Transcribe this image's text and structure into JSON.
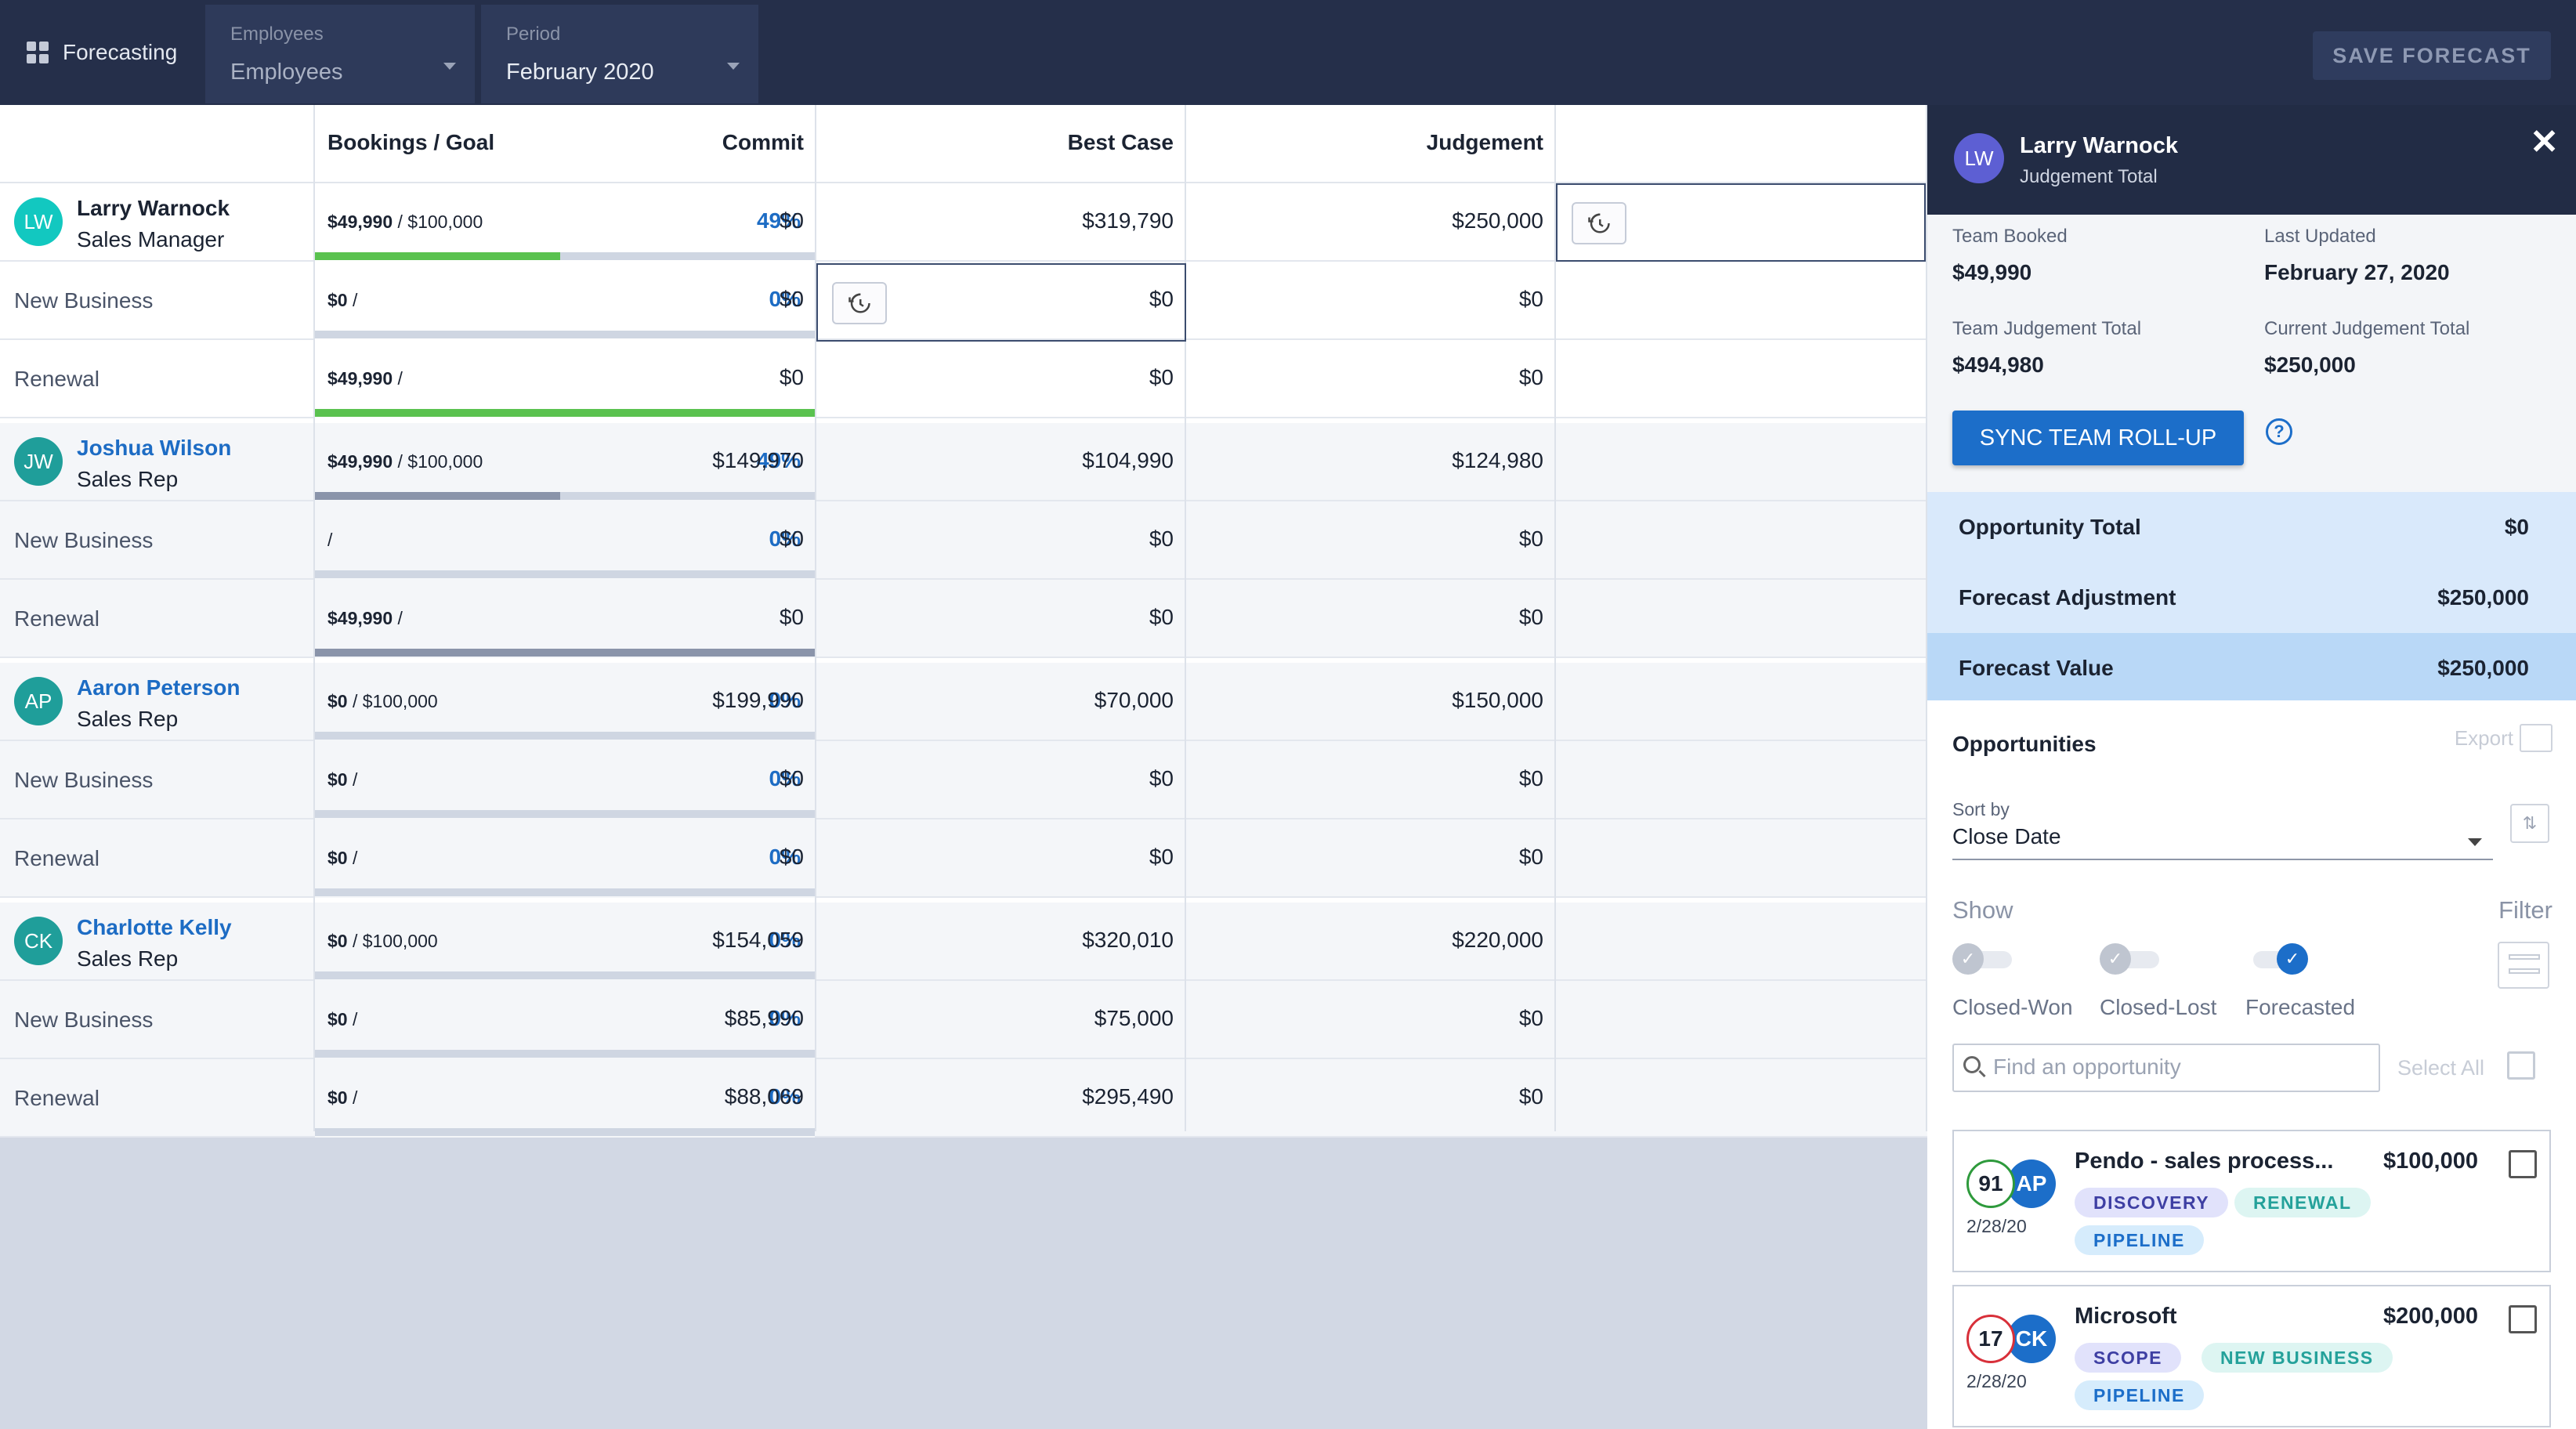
{
  "topbar": {
    "home_label": "Forecasting",
    "employees_label": "Employees",
    "employees_value": "Employees",
    "period_label": "Period",
    "period_value": "February 2020",
    "save_button": "SAVE FORECAST"
  },
  "grid": {
    "headers": {
      "bookings": "Bookings / Goal",
      "commit": "Commit",
      "best_case": "Best Case",
      "judgement": "Judgement"
    },
    "rows": [
      {
        "type": "person",
        "initials": "LW",
        "avatar_color": "#12c8c0",
        "name": "Larry Warnock",
        "role": "Sales Manager",
        "booked": "$49,990",
        "goal": " / $100,000",
        "pct": "49%",
        "progress": 0.49,
        "bar_color": "#5ac24f",
        "commit": "$0",
        "best_case": "$319,790",
        "judgement": "$250,000"
      },
      {
        "type": "sub",
        "label": "New Business",
        "booked": "$0",
        "goal": " /",
        "pct": "0%",
        "progress": 0,
        "bar_color": "#5ac24f",
        "commit": "$0",
        "best_case": "$0",
        "judgement": "$0"
      },
      {
        "type": "sub",
        "label": "Renewal",
        "booked": "$49,990",
        "goal": " /",
        "pct": "",
        "progress": 1.0,
        "bar_color": "#5ac24f",
        "commit": "$0",
        "best_case": "$0",
        "judgement": "$0"
      },
      {
        "type": "person",
        "initials": "JW",
        "avatar_color": "#1f9e9a",
        "name": "Joshua Wilson",
        "role": "Sales Rep",
        "booked": "$49,990",
        "goal": " / $100,000",
        "pct": "49%",
        "progress": 0.49,
        "bar_color": "#8a94aa",
        "commit": "$149,970",
        "best_case": "$104,990",
        "judgement": "$124,980"
      },
      {
        "type": "sub",
        "label": "New Business",
        "booked": "",
        "goal": "/",
        "pct": "0%",
        "progress": 0,
        "bar_color": "#8a94aa",
        "commit": "$0",
        "best_case": "$0",
        "judgement": "$0"
      },
      {
        "type": "sub",
        "label": "Renewal",
        "booked": "$49,990",
        "goal": " /",
        "pct": "",
        "progress": 1.0,
        "bar_color": "#8a94aa",
        "commit": "$0",
        "best_case": "$0",
        "judgement": "$0"
      },
      {
        "type": "person",
        "initials": "AP",
        "avatar_color": "#1f9e9a",
        "name": "Aaron Peterson",
        "role": "Sales Rep",
        "booked": "$0",
        "goal": " / $100,000",
        "pct": "0%",
        "progress": 0,
        "bar_color": "#8a94aa",
        "commit": "$199,990",
        "best_case": "$70,000",
        "judgement": "$150,000"
      },
      {
        "type": "sub",
        "label": "New Business",
        "booked": "$0",
        "goal": " /",
        "pct": "0%",
        "progress": 0,
        "bar_color": "#8a94aa",
        "commit": "$0",
        "best_case": "$0",
        "judgement": "$0"
      },
      {
        "type": "sub",
        "label": "Renewal",
        "booked": "$0",
        "goal": " /",
        "pct": "0%",
        "progress": 0,
        "bar_color": "#8a94aa",
        "commit": "$0",
        "best_case": "$0",
        "judgement": "$0"
      },
      {
        "type": "person",
        "initials": "CK",
        "avatar_color": "#1f9e9a",
        "name": "Charlotte Kelly",
        "role": "Sales Rep",
        "booked": "$0",
        "goal": " / $100,000",
        "pct": "0%",
        "progress": 0,
        "bar_color": "#8a94aa",
        "commit": "$154,059",
        "best_case": "$320,010",
        "judgement": "$220,000"
      },
      {
        "type": "sub",
        "label": "New Business",
        "booked": "$0",
        "goal": " /",
        "pct": "0%",
        "progress": 0,
        "bar_color": "#8a94aa",
        "commit": "$85,990",
        "best_case": "$75,000",
        "judgement": "$0"
      },
      {
        "type": "sub",
        "label": "Renewal",
        "booked": "$0",
        "goal": " /",
        "pct": "0%",
        "progress": 0,
        "bar_color": "#8a94aa",
        "commit": "$88,069",
        "best_case": "$295,490",
        "judgement": "$0"
      }
    ]
  },
  "panel": {
    "initials": "LW",
    "name": "Larry Warnock",
    "subtitle": "Judgement Total",
    "close": "✕",
    "team_booked_label": "Team Booked",
    "team_booked": "$49,990",
    "last_updated_label": "Last Updated",
    "last_updated": "February 27, 2020",
    "team_judgement_label": "Team Judgement Total",
    "team_judgement": "$494,980",
    "current_judgement_label": "Current Judgement Total",
    "current_judgement": "$250,000",
    "sync_button": "SYNC TEAM ROLL-UP",
    "help": "?",
    "summary": [
      {
        "label": "Opportunity Total",
        "value": "$0"
      },
      {
        "label": "Forecast Adjustment",
        "value": "$250,000"
      },
      {
        "label": "Forecast Value",
        "value": "$250,000"
      }
    ],
    "opps_title": "Opportunities",
    "export_label": "Export",
    "sort_label": "Sort by",
    "sort_value": "Close Date",
    "show_label": "Show",
    "filter_label": "Filter",
    "toggles": [
      {
        "label": "Closed-Won",
        "on": false
      },
      {
        "label": "Closed-Lost",
        "on": false
      },
      {
        "label": "Forecasted",
        "on": true
      }
    ],
    "search_placeholder": "Find an opportunity",
    "select_all": "Select All",
    "opportunities": [
      {
        "score": "91",
        "score_color": "green",
        "initials": "AP",
        "date": "2/28/20",
        "name": "Pendo - sales process...",
        "amount": "$100,000",
        "tags": [
          "DISCOVERY",
          "RENEWAL",
          "PIPELINE"
        ]
      },
      {
        "score": "17",
        "score_color": "red",
        "initials": "CK",
        "date": "2/28/20",
        "name": "Microsoft",
        "amount": "$200,000",
        "tags": [
          "SCOPE",
          "NEW BUSINESS",
          "PIPELINE"
        ]
      }
    ]
  }
}
